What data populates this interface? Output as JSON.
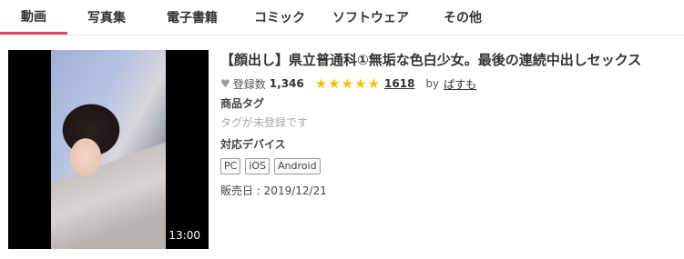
{
  "tabs": [
    {
      "label": "動画",
      "active": true
    },
    {
      "label": "写真集",
      "active": false
    },
    {
      "label": "電子書籍",
      "active": false
    },
    {
      "label": "コミック",
      "active": false
    },
    {
      "label": "ソフトウェア",
      "active": false
    },
    {
      "label": "その他",
      "active": false
    }
  ],
  "item": {
    "duration": "13:00",
    "title": "【顔出し】県立普通科①無垢な色白少女。最後の連続中出しセックス",
    "favorites_label": "登録数",
    "favorites_count": "1,346",
    "rating_stars": 5,
    "review_count": "1618",
    "by_label": "by",
    "author": "ぱすも",
    "tags_label": "商品タグ",
    "tags_note": "タグが未登録です",
    "devices_label": "対応デバイス",
    "devices": [
      "PC",
      "iOS",
      "Android"
    ],
    "release": "販売日 : 2019/12/21"
  },
  "colors": {
    "accent": "#e04763",
    "star": "#f2c200"
  },
  "icons": {
    "heart": "heart-icon",
    "star": "star-icon"
  }
}
